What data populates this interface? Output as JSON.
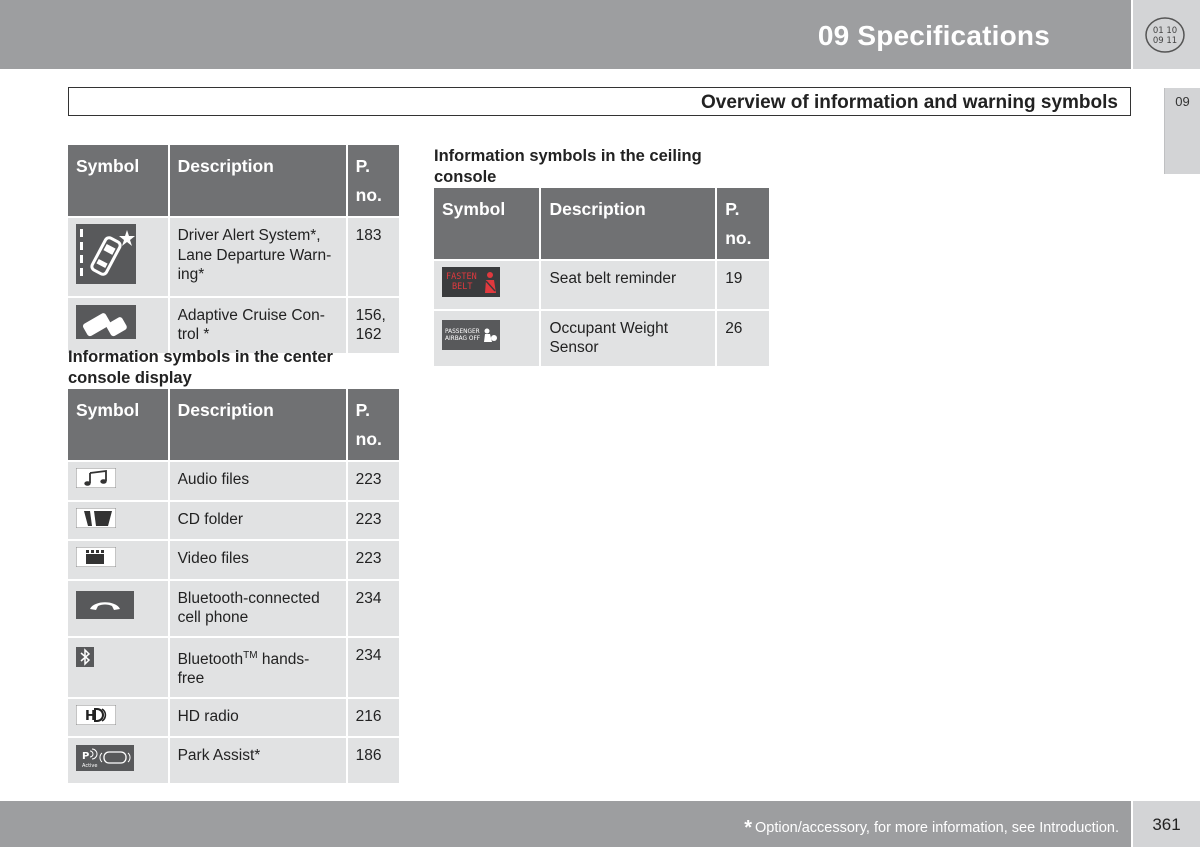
{
  "header": {
    "chapter_title": "09 Specifications",
    "logo_text": [
      "01 10",
      "09 11"
    ],
    "side_tab": "09"
  },
  "section_title": "Overview of information and warning symbols",
  "table_headers": {
    "symbol": "Symbol",
    "description": "Description",
    "page_p": "P.",
    "page_no": "no."
  },
  "table_main": {
    "rows": [
      {
        "icon": "driver-alert-icon",
        "description": "Driver Alert System*, Lane Departure Warn-ing*",
        "desc_lines": [
          "Driver Alert System*,",
          "Lane Departure Warn-",
          "ing*"
        ],
        "page": "183"
      },
      {
        "icon": "adaptive-cruise-icon",
        "description": "Adaptive Cruise Control *",
        "desc_lines": [
          "Adaptive Cruise Con-",
          "trol *"
        ],
        "page_lines": [
          "156,",
          "162"
        ]
      }
    ]
  },
  "center_console": {
    "caption": [
      "Information symbols in the center",
      "console display"
    ],
    "rows": [
      {
        "icon": "music-note-icon",
        "description": "Audio files",
        "page": "223"
      },
      {
        "icon": "cd-folder-icon",
        "description": "CD folder",
        "page": "223"
      },
      {
        "icon": "clapperboard-icon",
        "description": "Video files",
        "page": "223"
      },
      {
        "icon": "phone-handset-icon",
        "desc_lines": [
          "Bluetooth-connected",
          "cell phone"
        ],
        "page": "234"
      },
      {
        "icon": "bluetooth-icon",
        "desc_pre": "Bluetooth",
        "desc_sup": "TM",
        "desc_post": " hands-",
        "desc_line2": "free",
        "page": "234"
      },
      {
        "icon": "hd-radio-icon",
        "description": "HD radio",
        "page": "216"
      },
      {
        "icon": "park-assist-icon",
        "description": "Park Assist*",
        "page": "186"
      }
    ]
  },
  "ceiling_console": {
    "caption": [
      "Information symbols in the ceiling",
      "console"
    ],
    "rows": [
      {
        "icon": "fasten-belt-icon",
        "icon_text": [
          "FASTEN",
          "BELT"
        ],
        "description": "Seat belt reminder",
        "page": "19"
      },
      {
        "icon": "passenger-airbag-off-icon",
        "icon_text": [
          "PASSENGER",
          "AIRBAG OFF"
        ],
        "desc_lines": [
          "Occupant Weight",
          "Sensor"
        ],
        "page": "26"
      }
    ]
  },
  "footer": {
    "asterisk": "*",
    "note": "Option/accessory, for more information, see Introduction.",
    "page_number": "361"
  },
  "colors": {
    "header_gray": "#9d9ea0",
    "table_header": "#707173",
    "cell_bg": "#e1e2e3",
    "fasten_red": "#e0393e"
  }
}
